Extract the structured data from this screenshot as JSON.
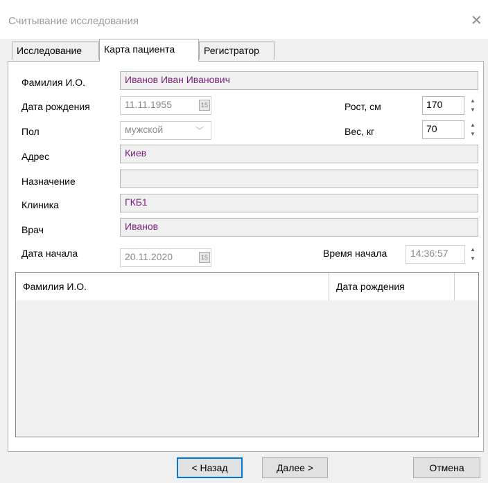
{
  "window": {
    "title": "Считывание исследования",
    "close_glyph": "✕"
  },
  "tabs": [
    {
      "label": "Исследование"
    },
    {
      "label": "Карта пациента"
    },
    {
      "label": "Регистратор"
    }
  ],
  "form": {
    "fio_label": "Фамилия И.О.",
    "fio_value": "Иванов Иван Иванович",
    "birth_label": "Дата рождения",
    "birth_value": "11.11.1955",
    "height_label": "Рост, см",
    "height_value": "170",
    "sex_label": "Пол",
    "sex_value": "мужской",
    "weight_label": "Вес, кг",
    "weight_value": "70",
    "address_label": "Адрес",
    "address_value": "Киев",
    "purpose_label": "Назначение",
    "purpose_value": "",
    "clinic_label": "Клиника",
    "clinic_value": "ГКБ1",
    "doctor_label": "Врач",
    "doctor_value": "Иванов",
    "start_date_label": "Дата начала",
    "start_date_value": "20.11.2020",
    "start_time_label": "Время начала",
    "start_time_value": "14:36:57"
  },
  "grid": {
    "columns": [
      "Фамилия И.О.",
      "Дата рождения"
    ]
  },
  "buttons": {
    "back": "< Назад",
    "next": "Далее >",
    "cancel": "Отмена"
  },
  "icons": {
    "calendar": "15",
    "spin_up": "▲",
    "spin_down": "▼",
    "combo_arrow": "﹀"
  }
}
